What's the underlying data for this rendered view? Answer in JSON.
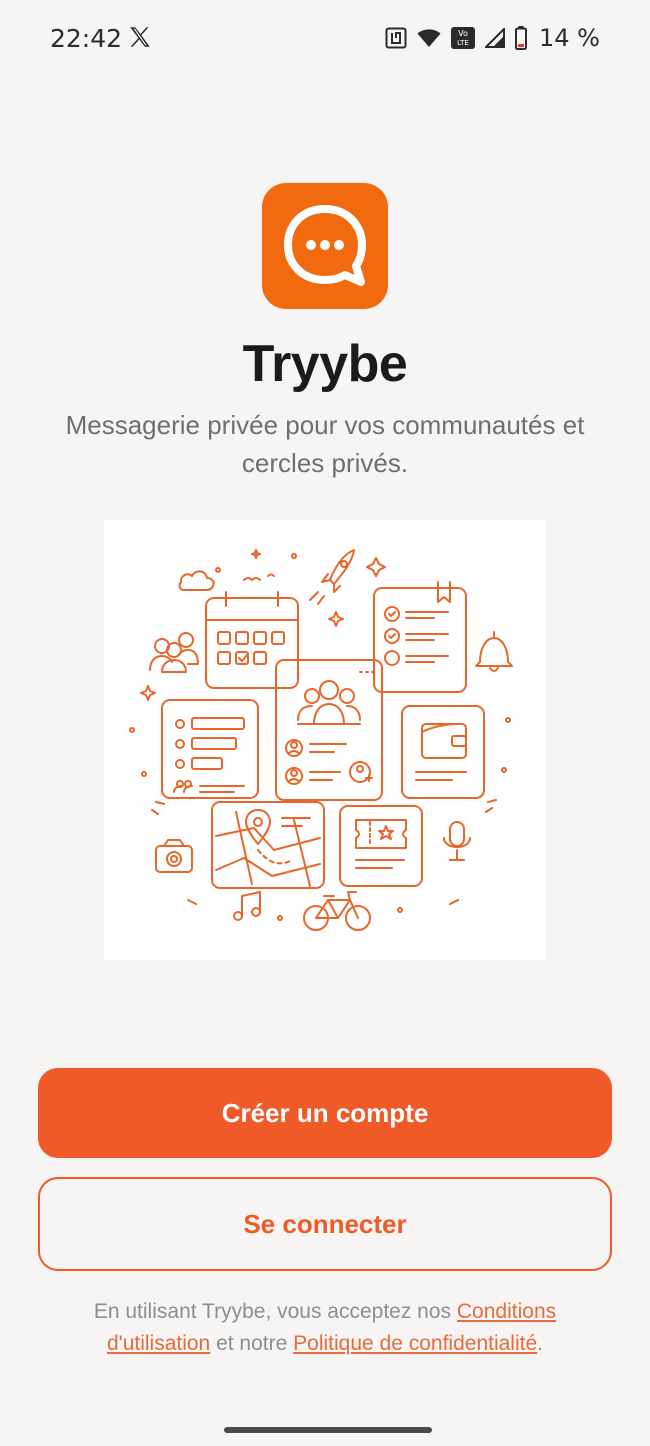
{
  "status_bar": {
    "time": "22:42",
    "battery": "14 %",
    "icons": [
      "x-logo-icon",
      "nfc-icon",
      "wifi-icon",
      "volte-icon",
      "signal-icon",
      "battery-icon"
    ]
  },
  "app": {
    "name": "Tryybe",
    "tagline": "Messagerie privée pour vos communautés et cercles privés.",
    "brand_color": "#f26a10",
    "accent_color": "#f05a28"
  },
  "actions": {
    "create_account": "Créer un compte",
    "sign_in": "Se connecter"
  },
  "legal": {
    "prefix": "En utilisant Tryybe, vous acceptez nos ",
    "terms_link": "Conditions d'utilisation",
    "middle": " et notre ",
    "privacy_link": "Politique de confidentialité",
    "suffix": "."
  }
}
